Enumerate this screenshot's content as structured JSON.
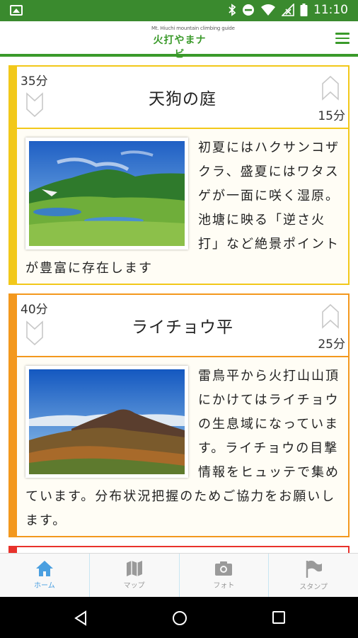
{
  "status_bar": {
    "time": "11:10",
    "icons": [
      "image-icon",
      "bluetooth-icon",
      "do-not-disturb-icon",
      "wifi-icon",
      "no-signal-icon",
      "battery-icon"
    ]
  },
  "header": {
    "logo_subtitle": "Mt. Hiuchi mountain climbing guide",
    "logo_title": "火打やまナビ",
    "menu_icon": "hamburger-menu-icon"
  },
  "cards": [
    {
      "accent_color": "#f2c81a",
      "time_top": "35分",
      "title": "天狗の庭",
      "time_bottom": "15分",
      "description": "初夏にはハクサンコザクラ、盛夏にはワタスゲが一面に咲く湿原。池塘に映る「逆さ火打」など絶景ポイントが豊富に存在します"
    },
    {
      "accent_color": "#f3981e",
      "time_top": "40分",
      "title": "ライチョウ平",
      "time_bottom": "25分",
      "description": "雷鳥平から火打山山頂にかけてはライチョウの生息域になっています。ライチョウの目撃情報をヒュッテで集めています。分布状況把握のためご協力をお願いします。"
    },
    {
      "accent_color": "#e8322c"
    }
  ],
  "tabs": [
    {
      "label": "ホーム",
      "icon": "home-icon",
      "active": true
    },
    {
      "label": "マップ",
      "icon": "map-icon",
      "active": false
    },
    {
      "label": "フォト",
      "icon": "camera-icon",
      "active": false
    },
    {
      "label": "スタンプ",
      "icon": "flag-icon",
      "active": false
    }
  ],
  "colors": {
    "status_bar": "#3a8a2e",
    "brand_green": "#3a9a2a",
    "tab_active": "#4a9fe0"
  }
}
